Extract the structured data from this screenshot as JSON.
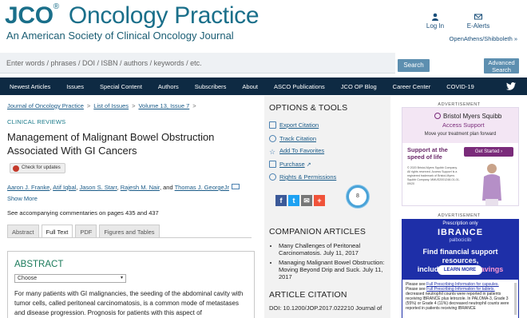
{
  "header": {
    "logo_jco": "JCO",
    "logo_reg": "®",
    "logo_rest": "Oncology Practice",
    "tagline": "An American Society of Clinical Oncology Journal",
    "login": "Log In",
    "ealerts": "E-Alerts",
    "institution": "OpenAthens/Shibboleth »"
  },
  "search": {
    "placeholder": "Enter words / phrases / DOI / ISBN / authors / keywords / etc.",
    "button": "Search",
    "advanced_line1": "Advanced",
    "advanced_line2": "Search"
  },
  "nav": {
    "items": [
      "Newest Articles",
      "Issues",
      "Special Content",
      "Authors",
      "Subscribers",
      "About",
      "ASCO Publications",
      "JCO OP Blog",
      "Career Center",
      "COVID-19"
    ]
  },
  "breadcrumb": {
    "items": [
      "Journal of Oncology Practice",
      "List of Issues",
      "Volume 13, Issue 7"
    ],
    "sep": ">"
  },
  "article": {
    "section": "CLINICAL REVIEWS",
    "title": "Management of Malignant Bowel Obstruction Associated With GI Cancers",
    "check_updates": "Check for updates",
    "authors": [
      "Aaron J. Franke",
      "Atif Iqbal",
      "Jason S. Starr",
      "Rajesh M. Nair",
      "Thomas J. GeorgeJr"
    ],
    "author_sep": ", ",
    "author_and": ", and ",
    "show_more": "Show More",
    "commentaries": "See accompanying commentaries on pages 435 and 437"
  },
  "tabs": [
    "Abstract",
    "Full Text",
    "PDF",
    "Figures and Tables"
  ],
  "abstract": {
    "heading": "ABSTRACT",
    "choose": "Choose",
    "text": "For many patients with GI malignancies, the seeding of the abdominal cavity with tumor cells, called peritoneal carcinomatosis, is a common mode of metastases and disease progression. Prognosis for patients with this aspect of"
  },
  "options": {
    "heading": "OPTIONS & TOOLS",
    "items": [
      "Export Citation",
      "Track Citation",
      "Add To Favorites",
      "Purchase",
      "Rights & Permissions"
    ],
    "badge": "8"
  },
  "companion": {
    "heading": "COMPANION ARTICLES",
    "items": [
      "Many Challenges of Peritoneal Carcinomatosis. July 11, 2017",
      "Managing Malignant Bowel Obstruction: Moving Beyond Drip and Suck. July 11, 2017"
    ]
  },
  "citation": {
    "heading": "ARTICLE CITATION",
    "doi": "DOI: 10.1200/JOP.2017.022210 Journal of"
  },
  "ads": {
    "label": "ADVERTISEMENT",
    "ad1": {
      "brand": "Bristol Myers Squibb",
      "program": "Access Support",
      "sub": "Move your treatment plan forward",
      "support": "Support at the speed of life",
      "cta": "Get Started ›",
      "fine": "© 2020 Bristol-Myers Squibb Company. All rights reserved. Access Support is a registered trademark of Bristol-Myers Squibb Company. MMUS2001248-01-01-09/20"
    },
    "ad2": {
      "rx": "Prescription only",
      "brand": "IBRANCE",
      "generic": "palbociclib",
      "headline1": "Find financial support resources,",
      "headline2": "including ",
      "headline_hl": "co-pay savings",
      "cta": "LEARN MORE",
      "line1_pre": "Please see ",
      "line1_link": "Full Prescribing Information for capsules.",
      "line2_pre": "Please see ",
      "line2_link": "Full Prescribing Information for tablets.",
      "line3": "decreased neutrophil counts were reported in patients receiving IBRANCE plus letrozole. In PALOMA-3, Grade 3 (55%) or Grade 4 (11%) decreased neutrophil counts were reported in patients receiving IBRANCE"
    }
  },
  "colors": {
    "brand": "#1a6f8a",
    "nav_bg": "#0e2a43",
    "link": "#1a5b88",
    "abstract_heading": "#1a7a5a",
    "button": "#5d8fb0"
  }
}
